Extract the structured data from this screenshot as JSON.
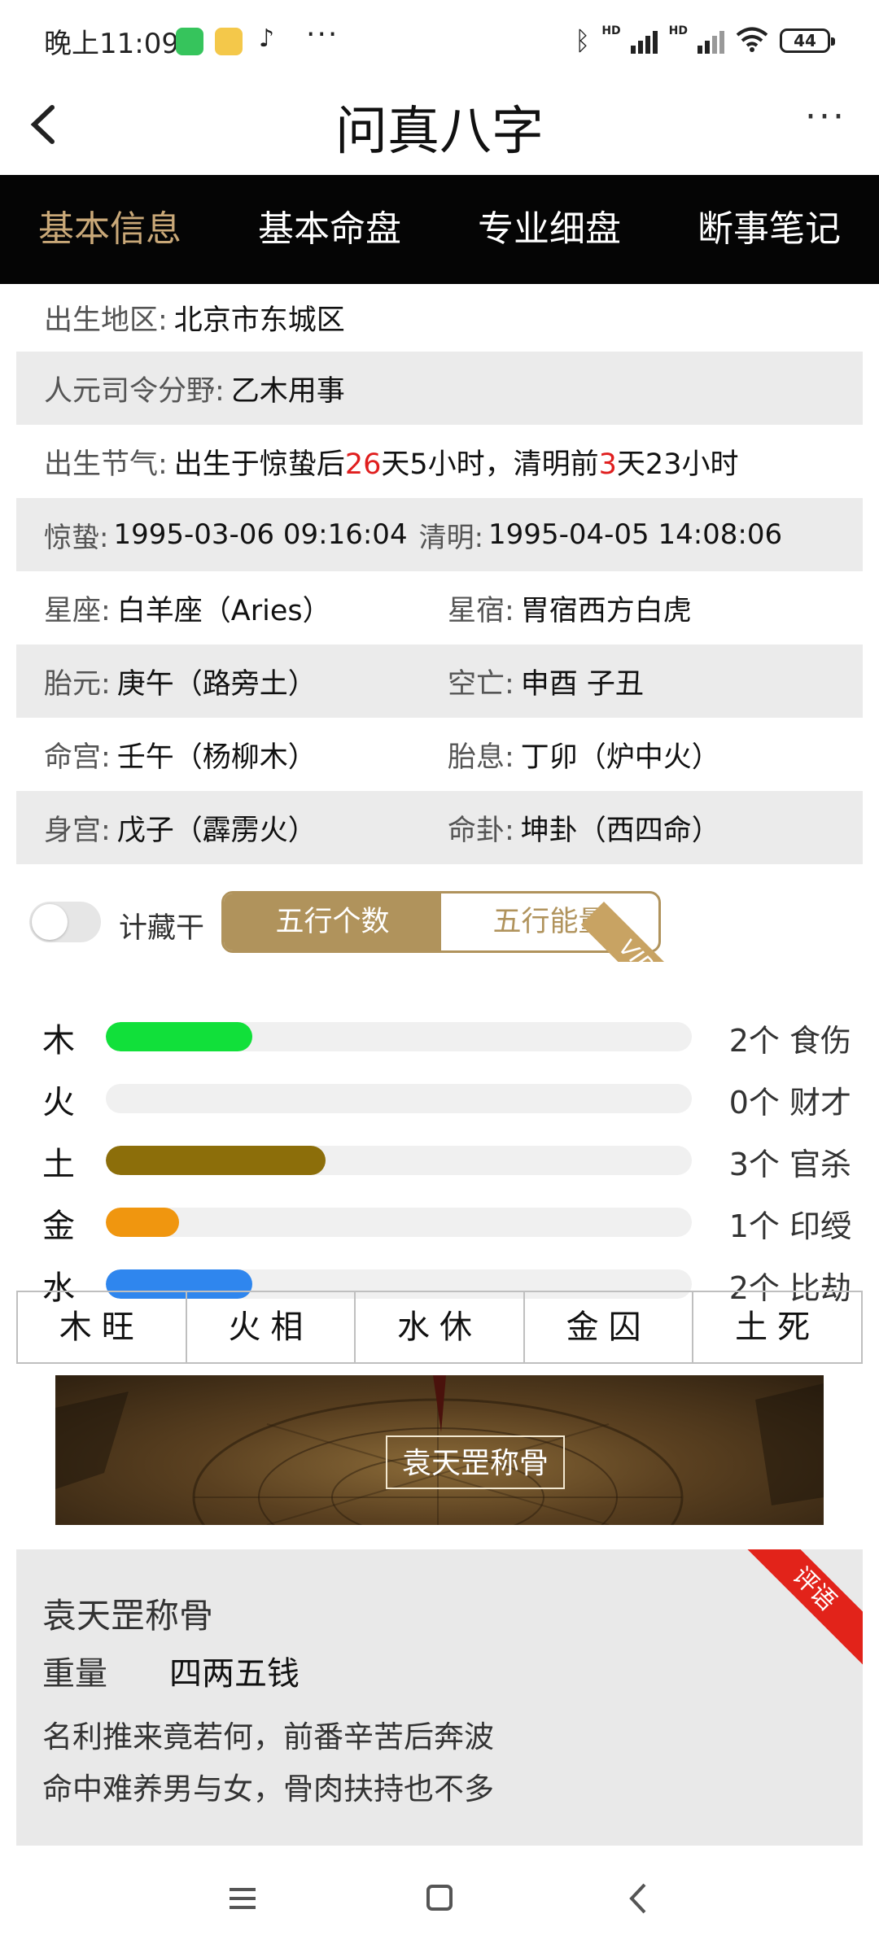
{
  "status_bar": {
    "time": "晚上11:09",
    "dots": "···",
    "hd1": "HD",
    "hd2": "HD",
    "battery": "44"
  },
  "header": {
    "title": "问真八字",
    "back_icon": "chevron-left-icon",
    "more_label": "···"
  },
  "tabs": [
    {
      "label": "基本信息",
      "active": true
    },
    {
      "label": "基本命盘",
      "active": false
    },
    {
      "label": "专业细盘",
      "active": false
    },
    {
      "label": "断事笔记",
      "active": false
    }
  ],
  "info": {
    "birth_region_label": "出生地区:",
    "birth_region": "北京市东城区",
    "renyuan_label": "人元司令分野:",
    "renyuan": "乙木用事",
    "jieqi_label": "出生节气:",
    "jieqi_part1": "出生于惊蛰后",
    "jieqi_days_after": "26",
    "jieqi_part2": "天5小时，清明前",
    "jieqi_days_before": "3",
    "jieqi_part3": "天23小时",
    "jingzhe_label": "惊蛰:",
    "jingzhe": "1995-03-06 09:16:04",
    "qingming_label": "清明:",
    "qingming": "1995-04-05 14:08:06",
    "xingzuo_label": "星座:",
    "xingzuo": "白羊座（Aries）",
    "xingxiu_label": "星宿:",
    "xingxiu": "胃宿西方白虎",
    "taiyuan_label": "胎元:",
    "taiyuan": "庚午（路旁土）",
    "kongwang_label": "空亡:",
    "kongwang": "申酉 子丑",
    "minggong_label": "命宫:",
    "minggong": "壬午（杨柳木）",
    "taixi_label": "胎息:",
    "taixi": "丁卯（炉中火）",
    "shengong_label": "身宫:",
    "shengong": "戊子（霹雳火）",
    "minggua_label": "命卦:",
    "minggua": "坤卦（西四命）"
  },
  "wuxing": {
    "toggle_label": "计藏干",
    "toggle_on": false,
    "seg_count": "五行个数",
    "seg_energy": "五行能量",
    "vip_badge": "VIP",
    "max_count": 8,
    "bars": [
      {
        "element": "木",
        "count": 2,
        "label": "2个 食伤",
        "color": "#11e03a"
      },
      {
        "element": "火",
        "count": 0,
        "label": "0个 财才",
        "color": "#e53935"
      },
      {
        "element": "土",
        "count": 3,
        "label": "3个 官杀",
        "color": "#8c6e0a"
      },
      {
        "element": "金",
        "count": 1,
        "label": "1个 印绶",
        "color": "#f0960f"
      },
      {
        "element": "水",
        "count": 2,
        "label": "2个 比劫",
        "color": "#2f86ee"
      }
    ],
    "states": [
      "木旺",
      "火相",
      "水休",
      "金囚",
      "土死"
    ]
  },
  "banner": {
    "label": "袁天罡称骨"
  },
  "verse": {
    "title": "袁天罡称骨",
    "weight_label": "重量",
    "weight": "四两五钱",
    "line1": "名利推来竟若何，前番辛苦后奔波",
    "line2": "命中难养男与女，骨肉扶持也不多",
    "ribbon": "评语"
  },
  "nav": {
    "menu_icon": "menu-icon",
    "home_icon": "home-icon",
    "back_icon": "back-triangle-icon"
  },
  "colors": {
    "tab_active": "#c9a878",
    "gold": "#b0935c",
    "red_accent": "#e01e1e"
  }
}
